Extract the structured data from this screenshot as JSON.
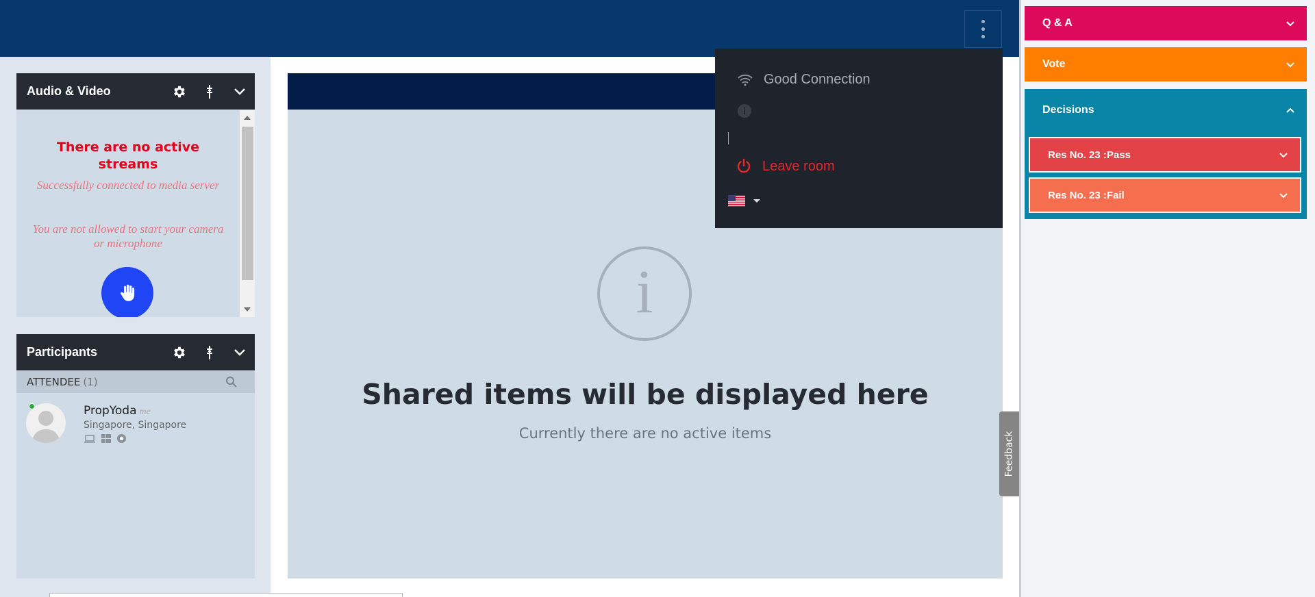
{
  "header": {
    "menu_icon": "more-vertical-icon"
  },
  "audio_video": {
    "title": "Audio & Video",
    "no_streams": "There are no active streams",
    "connected_msg": "Successfully connected to media server",
    "not_allowed_msg": "You are not allowed to start your camera or microphone",
    "icons": [
      "gear-icon",
      "pin-icon",
      "chevron-down-icon",
      "raise-hand-icon"
    ]
  },
  "participants": {
    "title": "Participants",
    "attendee_label": "ATTENDEE",
    "attendee_count": "(1)",
    "people": [
      {
        "name": "PropYoda",
        "tag": "me",
        "location": "Singapore, Singapore",
        "status": "online"
      }
    ],
    "icons": [
      "gear-icon",
      "pin-icon",
      "chevron-down-icon",
      "search-icon",
      "laptop-icon",
      "windows-icon",
      "chrome-icon"
    ]
  },
  "stage": {
    "title": "Shared items will be displayed here",
    "subtitle": "Currently there are no active items",
    "icon": "info-icon"
  },
  "feedback": {
    "label": "Feedback"
  },
  "menu": {
    "connection": "Good Connection",
    "leave": "Leave room",
    "language_flag": "us-flag-icon",
    "icons": [
      "wifi-icon",
      "info-icon",
      "power-icon"
    ]
  },
  "right_panel": {
    "qa": {
      "label": "Q & A",
      "color": "#dd0a5b"
    },
    "vote": {
      "label": "Vote",
      "color": "#ff7e00"
    },
    "decisions": {
      "label": "Decisions",
      "color": "#0885a6",
      "items": [
        {
          "label": "Res No. 23 :Pass",
          "color": "#e34346"
        },
        {
          "label": "Res No. 23 :Fail",
          "color": "#f56f4f"
        }
      ]
    }
  }
}
